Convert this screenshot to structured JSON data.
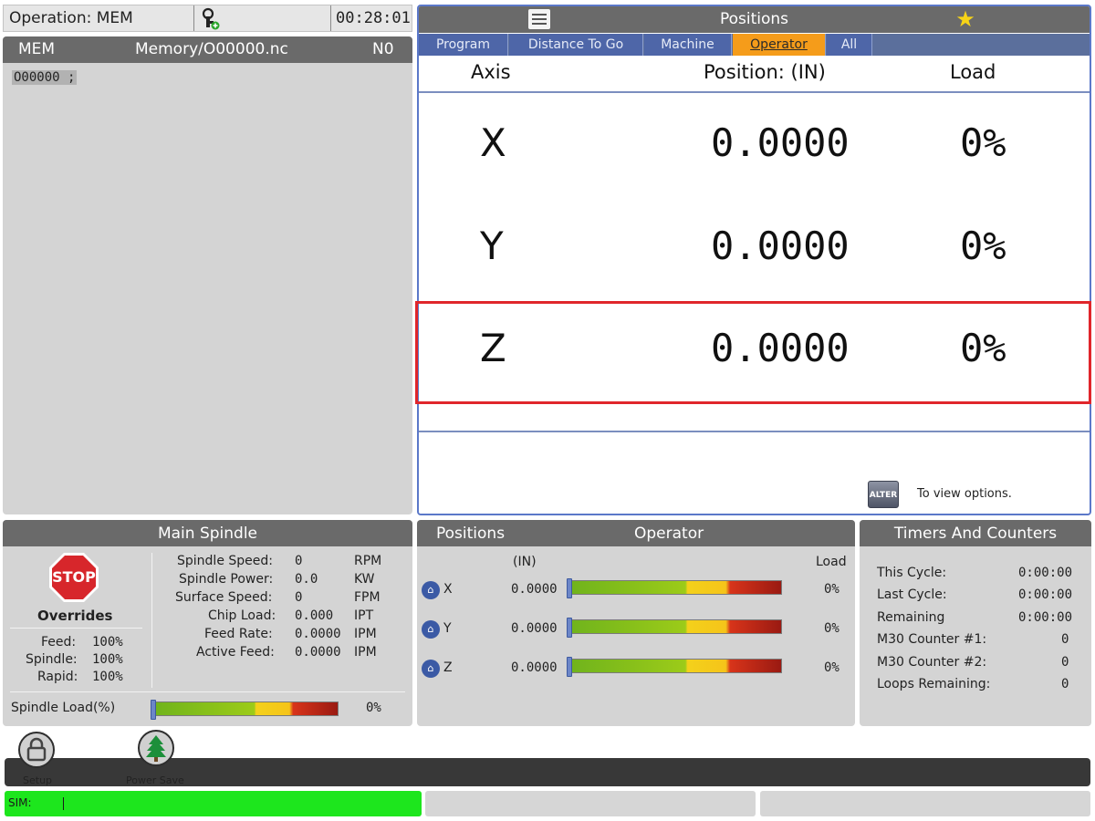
{
  "operation_bar": {
    "operation": "Operation: MEM",
    "time": "00:28:01"
  },
  "program_panel": {
    "mode": "MEM",
    "file": "Memory/O00000.nc",
    "line": "N0",
    "code": "O00000 ;"
  },
  "positions_panel": {
    "title": "Positions",
    "tabs": [
      "Program",
      "Distance To Go",
      "Machine",
      "Operator",
      "All"
    ],
    "active_tab": "Operator",
    "columns": {
      "axis": "Axis",
      "position": "Position:  (IN)",
      "load": "Load"
    },
    "rows": [
      {
        "axis": "X",
        "position": "0.0000",
        "load": "0%"
      },
      {
        "axis": "Y",
        "position": "0.0000",
        "load": "0%"
      },
      {
        "axis": "Z",
        "position": "0.0000",
        "load": "0%"
      }
    ],
    "highlighted_row": "Z",
    "alter_button": "ALTER",
    "hint": "To view options."
  },
  "main_spindle": {
    "title": "Main Spindle",
    "stop": "STOP",
    "overrides_title": "Overrides",
    "overrides": [
      {
        "label": "Feed:",
        "value": "100%"
      },
      {
        "label": "Spindle:",
        "value": "100%"
      },
      {
        "label": "Rapid:",
        "value": "100%"
      }
    ],
    "readings": [
      {
        "label": "Spindle Speed:",
        "value": "0",
        "unit": "RPM"
      },
      {
        "label": "Spindle Power:",
        "value": "0.0",
        "unit": "KW"
      },
      {
        "label": "Surface Speed:",
        "value": "0",
        "unit": "FPM"
      },
      {
        "label": "Chip Load:",
        "value": "0.000",
        "unit": "IPT"
      },
      {
        "label": "Feed Rate:",
        "value": "0.0000",
        "unit": "IPM"
      },
      {
        "label": "Active Feed:",
        "value": "0.0000",
        "unit": "IPM"
      }
    ],
    "spindle_load_label": "Spindle Load(%)",
    "spindle_load_value": "0%",
    "spindle_load_fraction": 0
  },
  "positions_widget": {
    "title": "Positions",
    "mode": "Operator",
    "unit": "(IN)",
    "load_label": "Load",
    "rows": [
      {
        "axis": "X",
        "value": "0.0000",
        "load": "0%",
        "load_fraction": 0
      },
      {
        "axis": "Y",
        "value": "0.0000",
        "load": "0%",
        "load_fraction": 0
      },
      {
        "axis": "Z",
        "value": "0.0000",
        "load": "0%",
        "load_fraction": 0
      }
    ]
  },
  "timers": {
    "title": "Timers And Counters",
    "rows": [
      {
        "label": "This Cycle:",
        "value": "0:00:00"
      },
      {
        "label": "Last Cycle:",
        "value": "0:00:00"
      },
      {
        "label": "Remaining",
        "value": "0:00:00"
      },
      {
        "label": "M30 Counter #1:",
        "value": "0"
      },
      {
        "label": "M30 Counter #2:",
        "value": "0"
      },
      {
        "label": "Loops Remaining:",
        "value": "0"
      }
    ]
  },
  "dock": {
    "setup": "Setup",
    "power_save": "Power Save"
  },
  "status": {
    "sim": "SIM:"
  },
  "colors": {
    "accent_tab": "#f59c1a",
    "panel_border": "#5b78c9",
    "highlight": "#e0262b",
    "sim_bar": "#1de61d"
  }
}
